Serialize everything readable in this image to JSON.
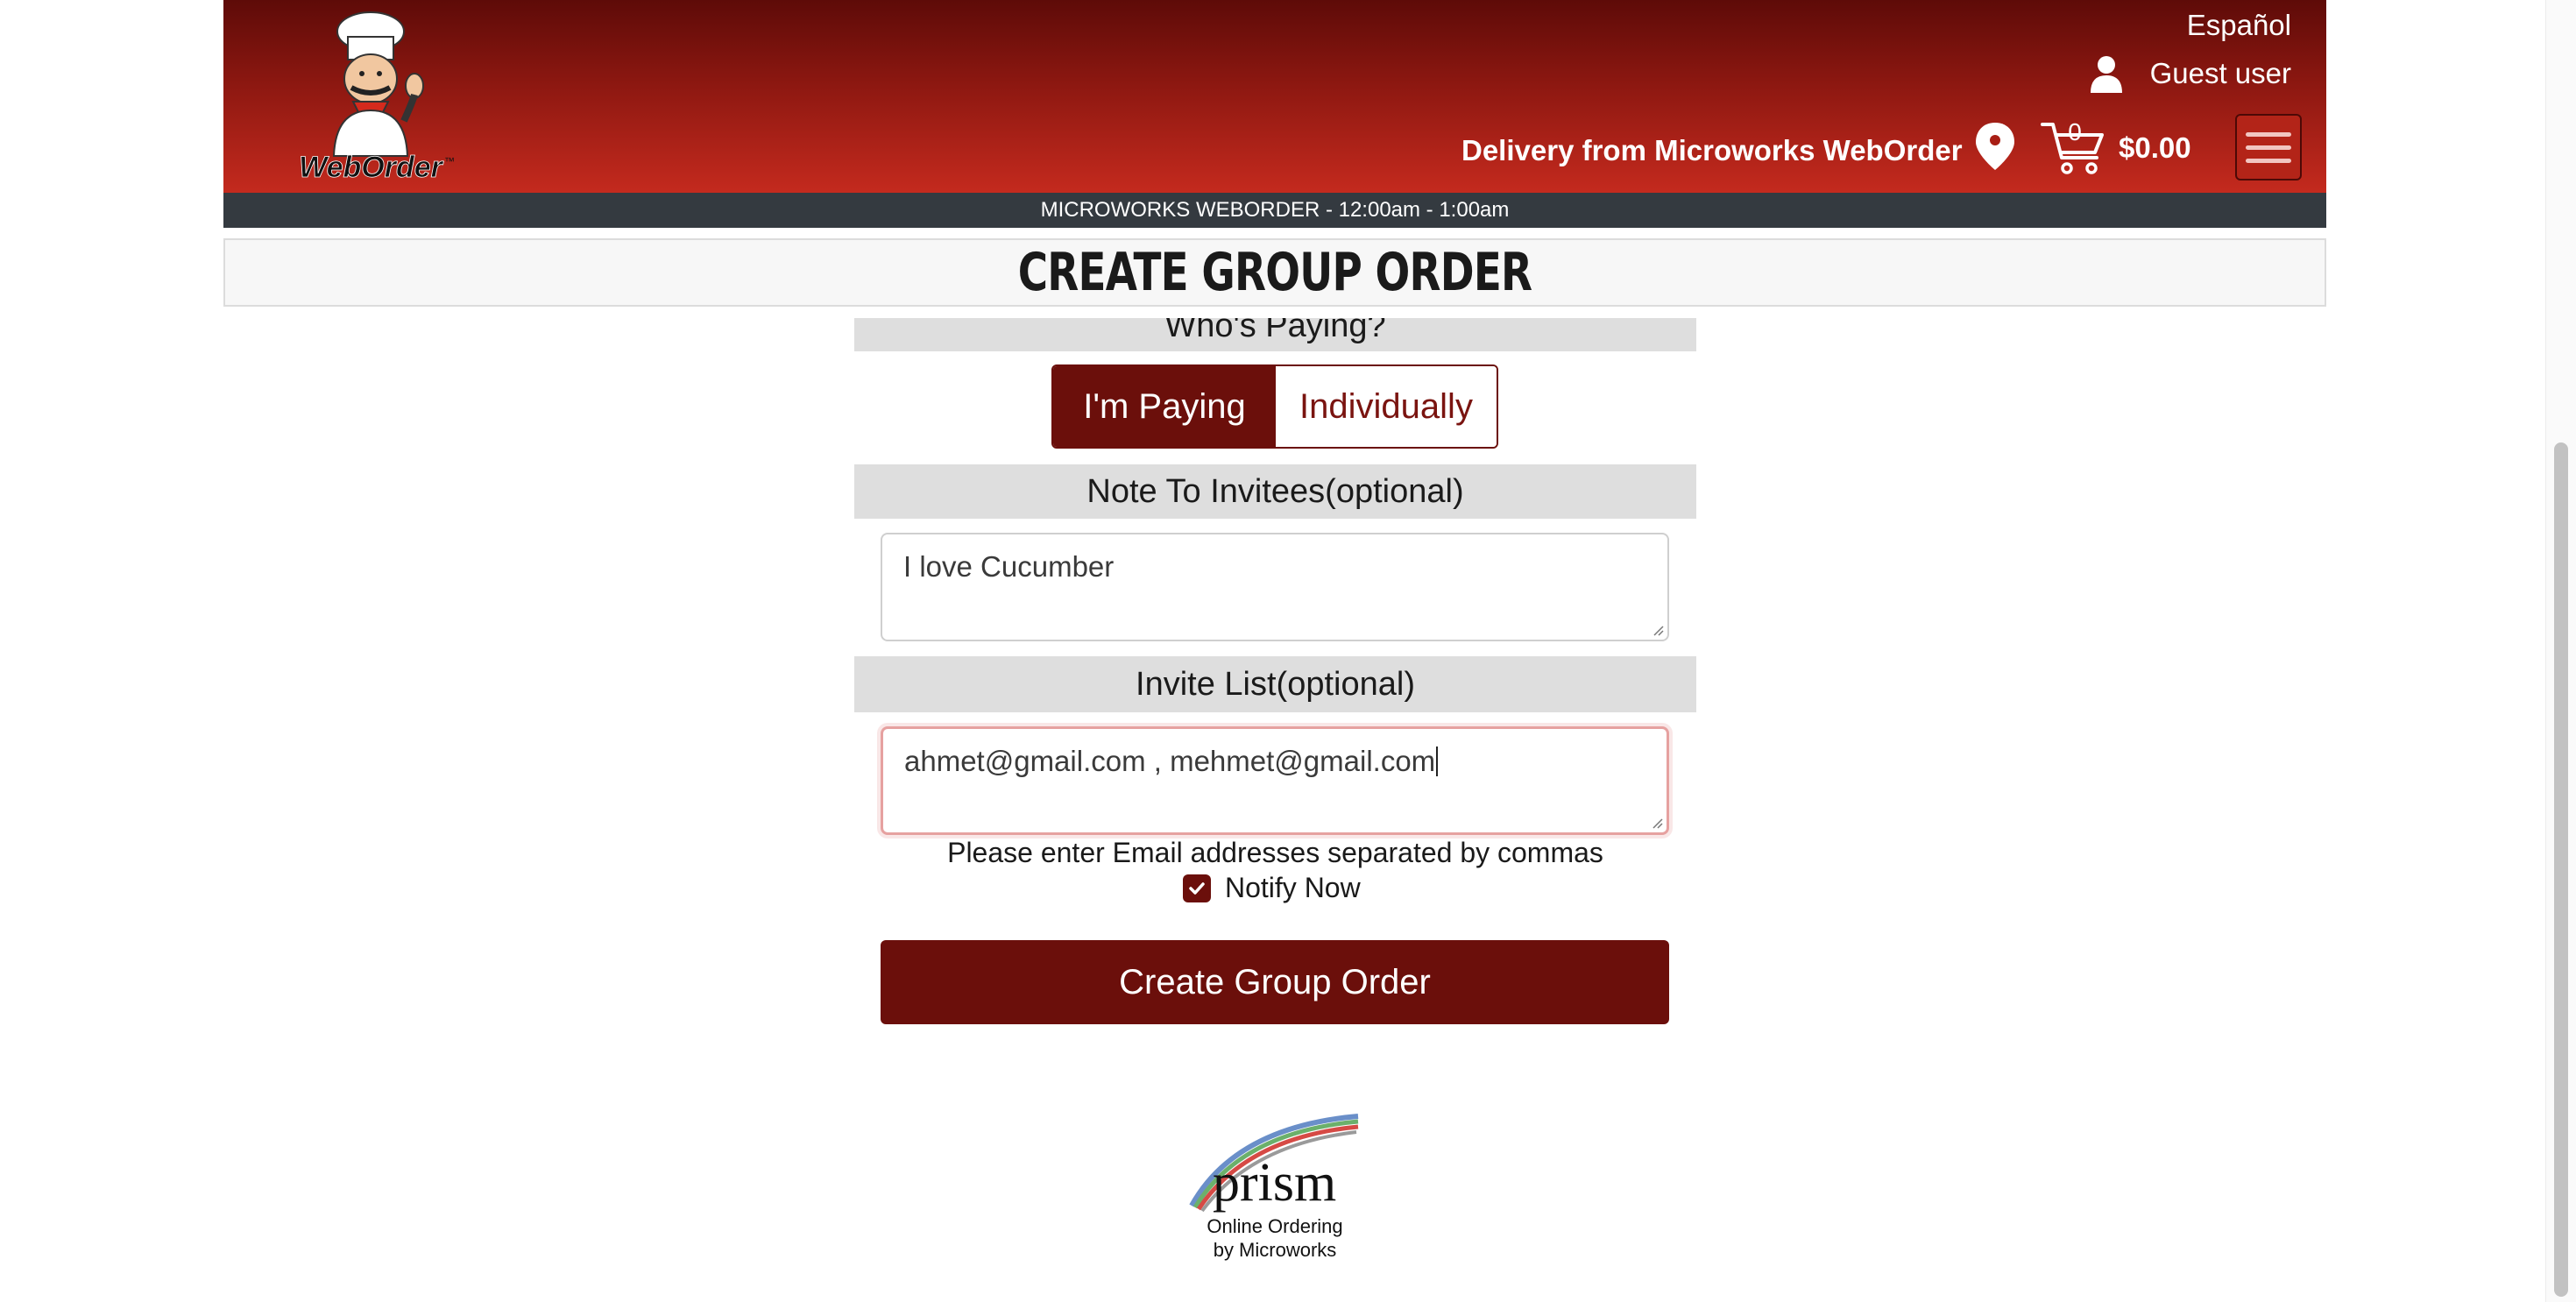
{
  "header": {
    "logo_text": "WebOrder",
    "language_link": "Español",
    "user_label": "Guest user",
    "delivery_text": "Delivery from Microworks WebOrder",
    "cart_count": "0",
    "cart_total": "$0.00"
  },
  "hours_bar": "MICROWORKS WEBORDER - 12:00am - 1:00am",
  "page_title": "Create Group Order",
  "who_paying": {
    "heading": "Who's Paying?",
    "option_selected": "I'm Paying",
    "option_other": "Individually"
  },
  "note": {
    "heading": "Note To Invitees(optional)",
    "value": "I love Cucumber"
  },
  "invite": {
    "heading": "Invite List(optional)",
    "value": "ahmet@gmail.com , mehmet@gmail.com",
    "helper": "Please enter Email addresses separated by commas"
  },
  "notify": {
    "label": "Notify Now",
    "checked": true
  },
  "submit_label": "Create Group Order",
  "footer": {
    "logo_text": "prism",
    "line1": "Online Ordering",
    "line2": "by Microworks"
  },
  "colors": {
    "brand_dark": "#6b0f0b",
    "header_top": "#5e0b08",
    "header_bottom": "#c42a1e",
    "hours_bar": "#343a40"
  }
}
